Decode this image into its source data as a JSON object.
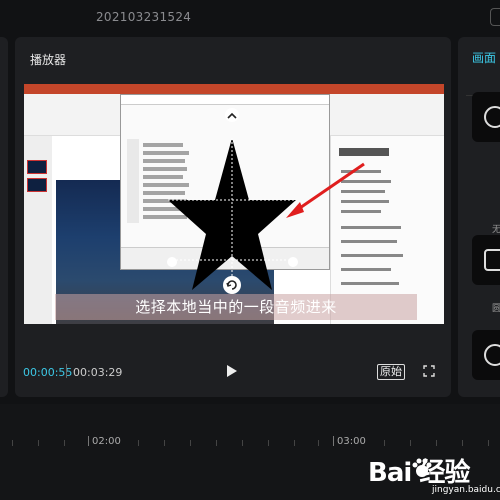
{
  "topbar": {
    "project_name": "202103231524"
  },
  "player": {
    "title": "播放器",
    "caption": "选择本地当中的一段音频进来",
    "time_current": "00:00:55",
    "time_total": "00:03:29",
    "ratio_label": "原始"
  },
  "right_panel": {
    "tab_label": "画面",
    "items": [
      {
        "label": "无"
      },
      {
        "label": "圆"
      },
      {
        "label": ""
      }
    ]
  },
  "timeline": {
    "ruler_labels": [
      "02:00",
      "03:00"
    ]
  },
  "watermark": {
    "text": "Bai 经验",
    "url": "jingyan.baidu.com"
  },
  "colors": {
    "accent": "#3cc8e6",
    "panel": "#1e1f22",
    "background": "#111214",
    "caption_bg": "#c8a2a2",
    "arrow": "#e01e1e"
  },
  "icons": {
    "play": "play-icon",
    "fullscreen": "fullscreen-icon",
    "rotate": "rotate-icon",
    "chevron_up": "chevron-up-icon"
  }
}
